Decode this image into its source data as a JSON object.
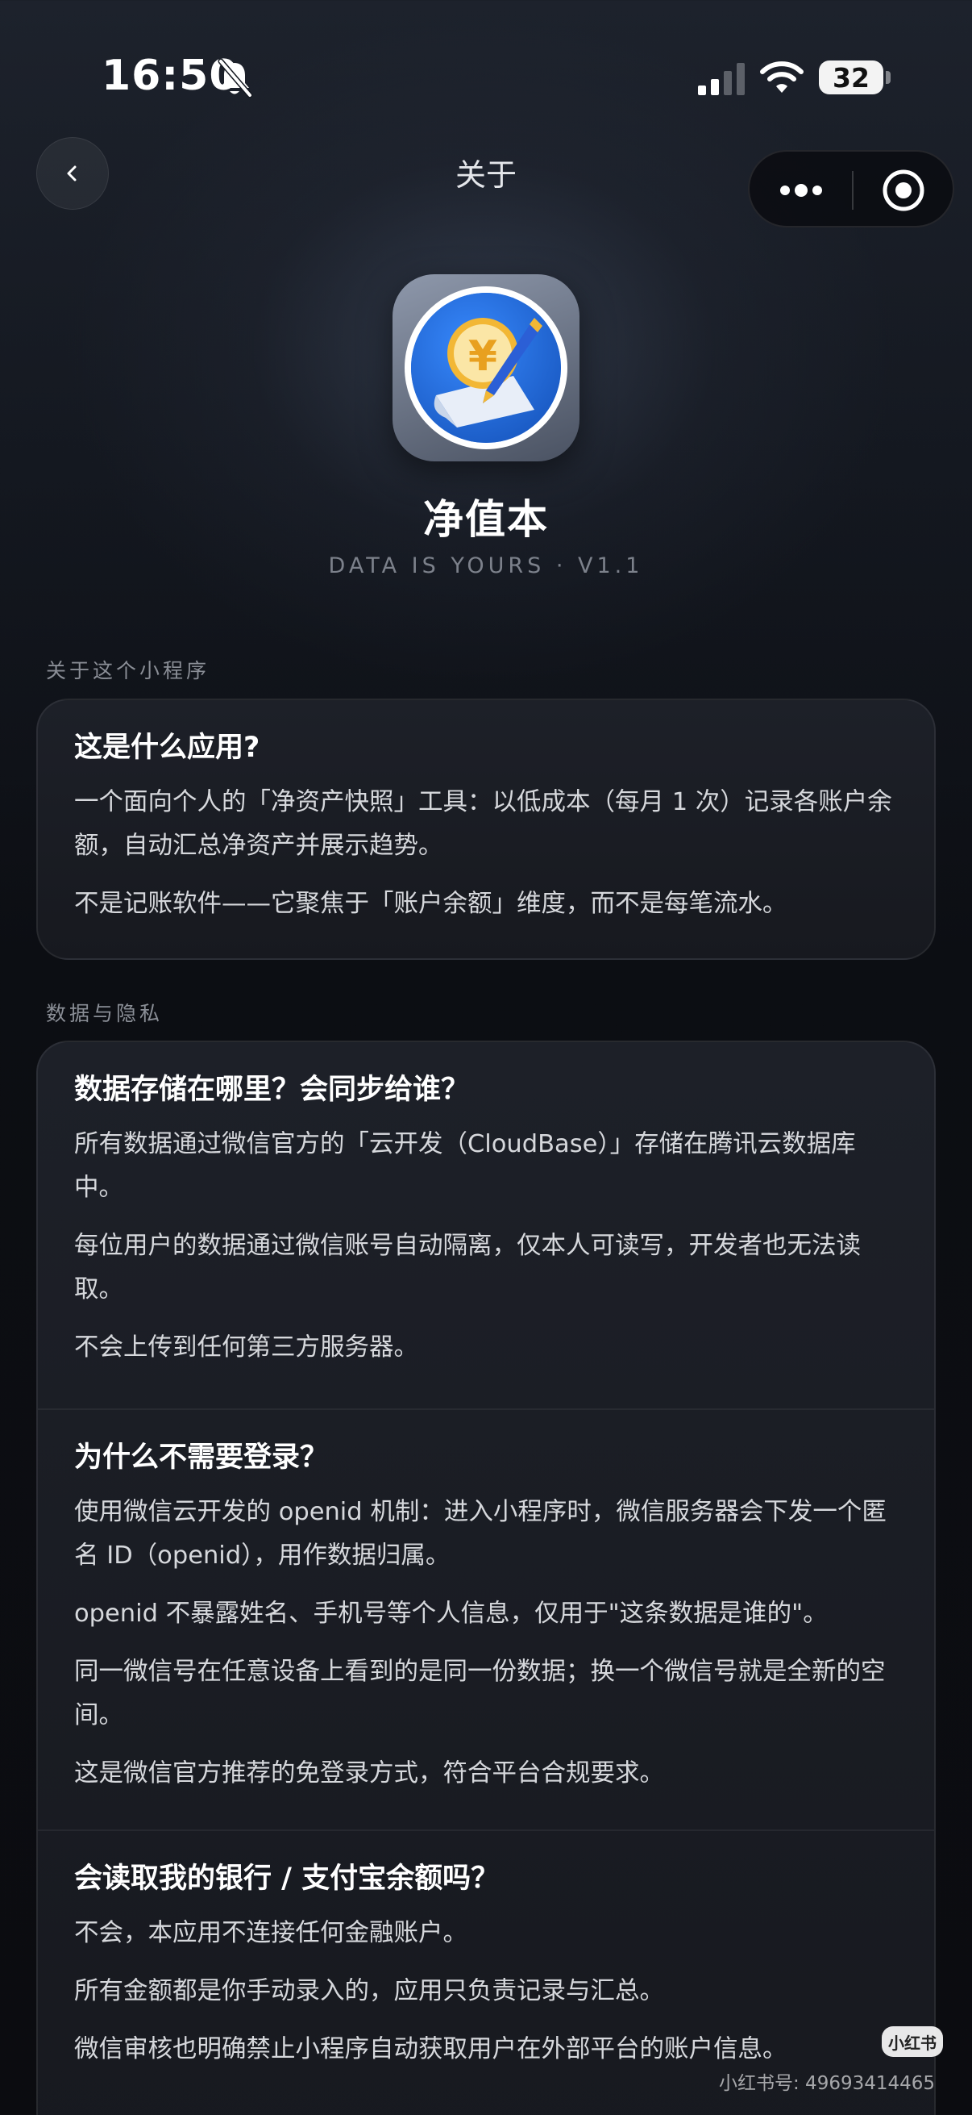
{
  "status_bar": {
    "time": "16:50",
    "battery": "32"
  },
  "nav": {
    "title": "关于"
  },
  "app": {
    "name": "净值本",
    "tagline": "DATA IS YOURS · V1.1"
  },
  "sections": [
    {
      "label": "关于这个小程序",
      "blocks": [
        {
          "heading": "这是什么应用?",
          "paragraphs": [
            "一个面向个人的「净资产快照」工具：以低成本（每月 1 次）记录各账户余额，自动汇总净资产并展示趋势。",
            "不是记账软件——它聚焦于「账户余额」维度，而不是每笔流水。"
          ]
        }
      ]
    },
    {
      "label": "数据与隐私",
      "blocks": [
        {
          "heading": "数据存储在哪里？会同步给谁？",
          "paragraphs": [
            "所有数据通过微信官方的「云开发（CloudBase）」存储在腾讯云数据库中。",
            "每位用户的数据通过微信账号自动隔离，仅本人可读写，开发者也无法读取。",
            "不会上传到任何第三方服务器。"
          ]
        },
        {
          "heading": "为什么不需要登录？",
          "paragraphs": [
            "使用微信云开发的 openid 机制：进入小程序时，微信服务器会下发一个匿名 ID（openid），用作数据归属。",
            "openid 不暴露姓名、手机号等个人信息，仅用于\"这条数据是谁的\"。",
            "同一微信号在任意设备上看到的是同一份数据；换一个微信号就是全新的空间。",
            "这是微信官方推荐的免登录方式，符合平台合规要求。"
          ]
        },
        {
          "heading": "会读取我的银行 / 支付宝余额吗？",
          "paragraphs": [
            "不会，本应用不连接任何金融账户。",
            "所有金额都是你手动录入的，应用只负责记录与汇总。",
            "微信审核也明确禁止小程序自动获取用户在外部平台的账户信息。"
          ]
        }
      ]
    }
  ],
  "watermark": {
    "badge": "小红书",
    "text": "小红书号: 49693414465"
  },
  "colors": {
    "background": "#0b0c10",
    "card": "#1b1d24",
    "accent_blue": "#1f6fe0",
    "coin_gold": "#f2b735"
  }
}
